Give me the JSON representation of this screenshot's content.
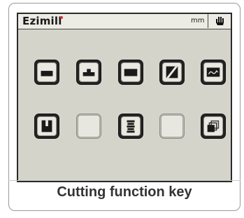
{
  "device": {
    "brand": "Ezimill",
    "unit": "mm",
    "mode_icon": "hand-icon"
  },
  "keys_row_1": [
    {
      "icon": "pocket-cut-icon"
    },
    {
      "icon": "boss-cut-icon"
    },
    {
      "icon": "face-mill-icon"
    },
    {
      "icon": "angle-cut-icon"
    },
    {
      "icon": "contour-cut-icon"
    }
  ],
  "keys_row_2": [
    {
      "icon": "slot-cut-icon"
    },
    {
      "icon": "blank-key"
    },
    {
      "icon": "stack-cut-icon"
    },
    {
      "icon": "blank-key"
    },
    {
      "icon": "layers-icon"
    }
  ],
  "caption": "Cutting function key",
  "colors": {
    "screen_bg": "#d5d4cb",
    "key_frame": "#242424",
    "key_face": "#e9e8e1",
    "brand_accent": "#e0302c"
  }
}
